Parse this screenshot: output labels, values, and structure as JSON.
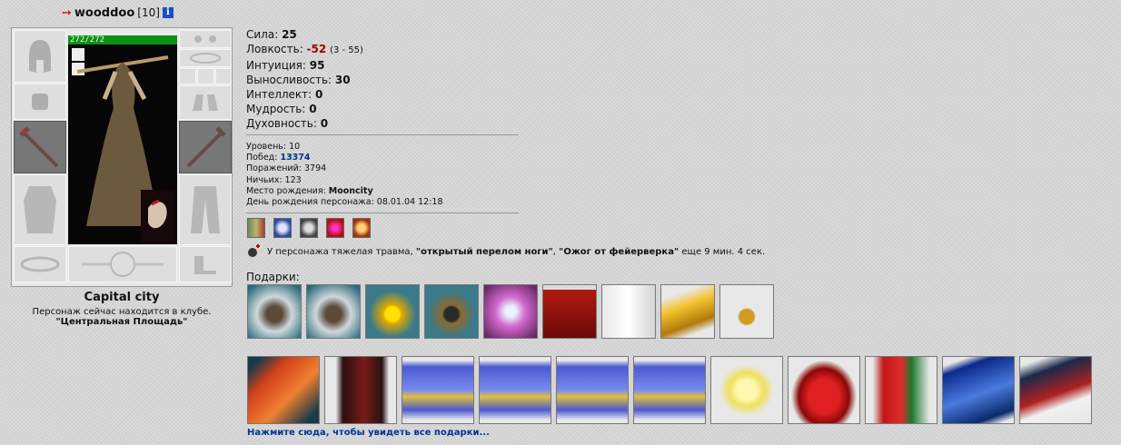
{
  "header": {
    "arrow": "➙",
    "nickname": "wooddoo",
    "level": "[10]",
    "info_icon": "i"
  },
  "character": {
    "hp": "272/272"
  },
  "location": {
    "city": "Capital city",
    "status": "Персонаж сейчас находится в клубе.",
    "room": "\"Центральная Площадь\""
  },
  "stats": [
    {
      "label": "Сила: ",
      "value": "25"
    },
    {
      "label": "Ловкость: ",
      "value": "-52",
      "extra": "(3 - 55)"
    },
    {
      "label": "Интуиция: ",
      "value": "95"
    },
    {
      "label": "Выносливость: ",
      "value": "30"
    },
    {
      "label": "Интеллект: ",
      "value": "0"
    },
    {
      "label": "Мудрость: ",
      "value": "0"
    },
    {
      "label": "Духовность: ",
      "value": "0"
    }
  ],
  "info": {
    "level": "Уровень: 10",
    "wins_label": "Побед: ",
    "wins": "13374",
    "losses": "Поражений: 3794",
    "draws": "Ничьих: 123",
    "birthplace_label": "Место рождения: ",
    "birthplace": "Mooncity",
    "birthday": "День рождения персонажа: 08.01.04 12:18"
  },
  "trauma": {
    "prefix": "У персонажа тяжелая травма, ",
    "t1": "\"открытый перелом ноги\"",
    "sep": ", ",
    "t2": "\"Ожог от фейерверка\"",
    "suffix": " еще 9 мин. 4 сек."
  },
  "gifts": {
    "label": "Подарки:",
    "row1": [
      "hedgehog-gift",
      "hedgehog-gift",
      "smiley-gift",
      "ring-box-gift",
      "pendant-gift",
      "red-banner-gift",
      "glass-gift",
      "gold-bars-gift",
      "medal-gift"
    ],
    "row2": [
      "red-gift-box",
      "gift-bag",
      "coin-jar",
      "coin-jar",
      "coin-jar",
      "coin-jar",
      "flower-egg",
      "red-bags",
      "gift-bags",
      "new-year-card",
      "new-year-card-2"
    ],
    "all_link": "Нажмите сюда, чтобы увидеть все подарки..."
  },
  "colors": {
    "hp_bar": "#0d8f14",
    "negative_stat": "#a00000",
    "link": "#003399"
  }
}
